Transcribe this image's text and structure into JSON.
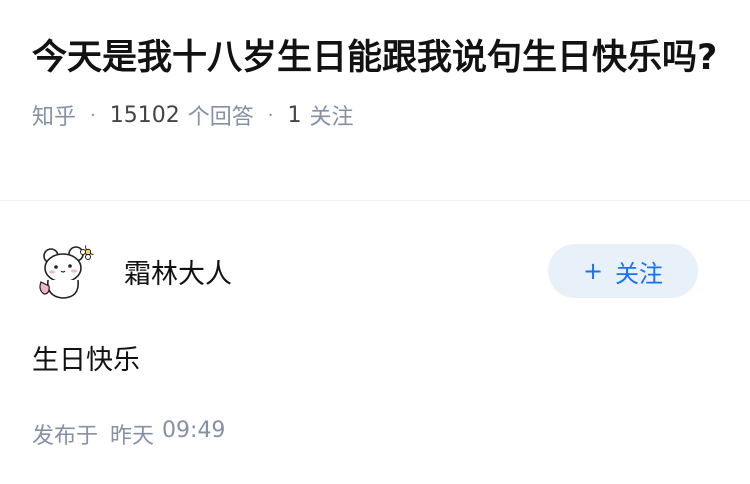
{
  "question": {
    "title": "今天是我十八岁生日能跟我说句生日快乐吗?",
    "source": "知乎",
    "answer_count": "15102",
    "answer_label": "个回答",
    "follow_count": "1",
    "follow_label": "关注"
  },
  "answer": {
    "author_name": "霜林大人",
    "follow_button_icon": "+",
    "follow_button_label": "关注",
    "content": "生日快乐",
    "publish_prefix": "发布于",
    "publish_day": "昨天",
    "publish_time": "09:49"
  },
  "colors": {
    "text_primary": "#121212",
    "text_secondary": "#8590a6",
    "brand_blue": "#1772f6",
    "follow_button_bg": "#e8f1fa"
  },
  "icons": {
    "avatar": "bear-avatar"
  }
}
